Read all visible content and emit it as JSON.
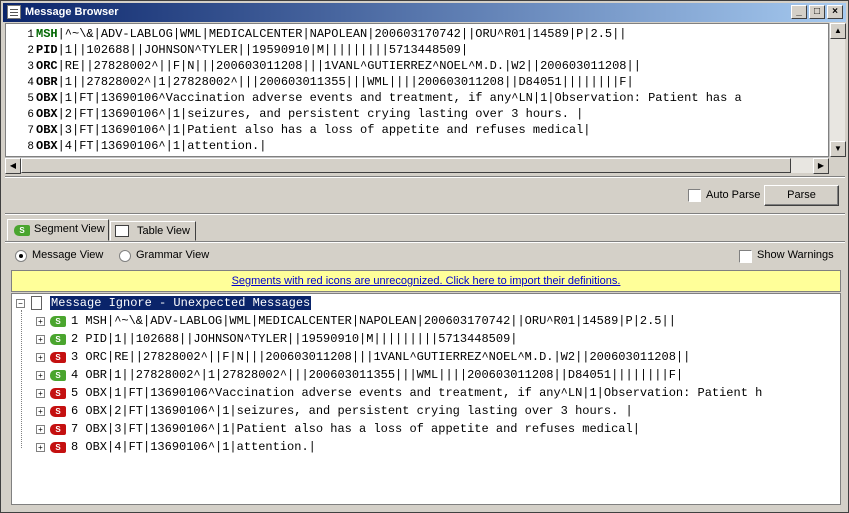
{
  "window": {
    "title": "Message Browser"
  },
  "editor": {
    "lines": [
      {
        "num": "1",
        "seg": "MSH",
        "rest": "|^~\\&|ADV-LABLOG|WML|MEDICALCENTER|NAPOLEAN|200603170742||ORU^R01|14589|P|2.5||"
      },
      {
        "num": "2",
        "seg": "PID",
        "rest": "|1||102688||JOHNSON^TYLER||19590910|M|||||||||5713448509|"
      },
      {
        "num": "3",
        "seg": "ORC",
        "rest": "|RE||27828002^||F|N|||200603011208|||1VANL^GUTIERREZ^NOEL^M.D.|W2||200603011208||"
      },
      {
        "num": "4",
        "seg": "OBR",
        "rest": "|1||27828002^|1|27828002^|||200603011355|||WML||||200603011208||D84051||||||||F|"
      },
      {
        "num": "5",
        "seg": "OBX",
        "rest": "|1|FT|13690106^Vaccination adverse events and treatment, if any^LN|1|Observation: Patient has a"
      },
      {
        "num": "6",
        "seg": "OBX",
        "rest": "|2|FT|13690106^|1|seizures, and persistent crying lasting over 3 hours. |"
      },
      {
        "num": "7",
        "seg": "OBX",
        "rest": "|3|FT|13690106^|1|Patient also has a loss of appetite and refuses medical|"
      },
      {
        "num": "8",
        "seg": "OBX",
        "rest": "|4|FT|13690106^|1|attention.|"
      }
    ]
  },
  "controls": {
    "auto_parse_label": "Auto Parse",
    "parse_button": "Parse"
  },
  "tabs": [
    {
      "label": "Segment View"
    },
    {
      "label": "Table View"
    }
  ],
  "view_options": {
    "message_view": "Message View",
    "grammar_view": "Grammar View",
    "show_warnings": "Show Warnings"
  },
  "banner": {
    "text": "Segments with red icons are unrecognized. Click here to import their definitions."
  },
  "tree": {
    "root_label": "Message Ignore - Unexpected Messages",
    "rows": [
      {
        "status": "green",
        "text": "1 MSH|^~\\&|ADV-LABLOG|WML|MEDICALCENTER|NAPOLEAN|200603170742||ORU^R01|14589|P|2.5||"
      },
      {
        "status": "green",
        "text": "2 PID|1||102688||JOHNSON^TYLER||19590910|M|||||||||5713448509|"
      },
      {
        "status": "red",
        "text": "3 ORC|RE||27828002^||F|N|||200603011208|||1VANL^GUTIERREZ^NOEL^M.D.|W2||200603011208||"
      },
      {
        "status": "green",
        "text": "4 OBR|1||27828002^|1|27828002^|||200603011355|||WML||||200603011208||D84051||||||||F|"
      },
      {
        "status": "red",
        "text": "5 OBX|1|FT|13690106^Vaccination adverse events and treatment, if any^LN|1|Observation: Patient h"
      },
      {
        "status": "red",
        "text": "6 OBX|2|FT|13690106^|1|seizures, and persistent crying lasting over 3 hours. |"
      },
      {
        "status": "red",
        "text": "7 OBX|3|FT|13690106^|1|Patient also has a loss of appetite and refuses medical|"
      },
      {
        "status": "red",
        "text": "8 OBX|4|FT|13690106^|1|attention.|"
      }
    ]
  },
  "colors": {
    "segment_green": "#006600",
    "separator_blue": "#0000cc",
    "icon_green": "#4aa52e",
    "icon_red": "#c41010"
  }
}
